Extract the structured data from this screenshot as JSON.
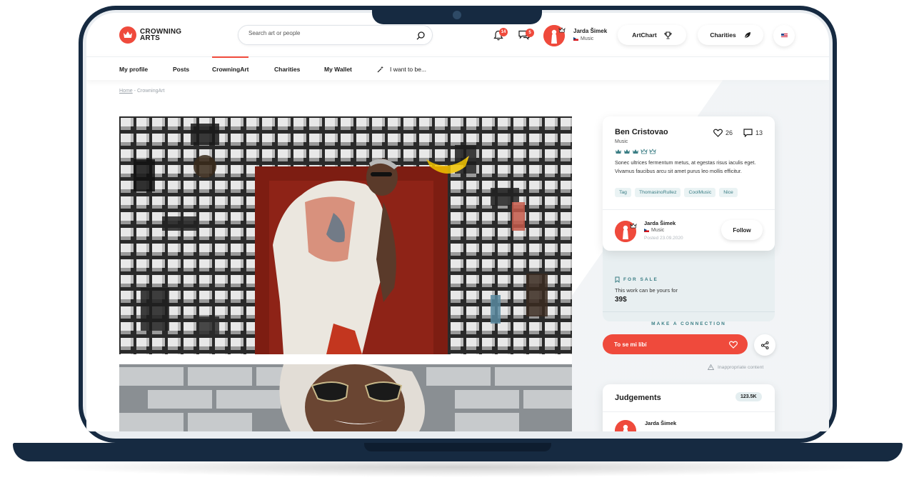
{
  "brand": {
    "line1": "CROWNING",
    "line2": "ARTS",
    "accent": "#ef4a3c",
    "navy": "#162a41"
  },
  "header": {
    "search_placeholder": "Search art or people",
    "notifications_count": "14",
    "messages_count": "5",
    "user": {
      "name": "Jarda Šimek",
      "category": "Music"
    },
    "artchart_label": "ArtChart",
    "charities_label": "Charities"
  },
  "nav": {
    "items": [
      {
        "label": "My profile"
      },
      {
        "label": "Posts"
      },
      {
        "label": "CrowningArt"
      },
      {
        "label": "Charities"
      },
      {
        "label": "My Wallet"
      }
    ],
    "want_label": "I want to be..."
  },
  "breadcrumb": {
    "home": "Home",
    "sep": "-",
    "current": "CrowningArt"
  },
  "artwork": {
    "artist": "Ben Cristovao",
    "category": "Music",
    "likes": "26",
    "comments": "13",
    "crowns_filled": 3,
    "crowns_total": 5,
    "description": "Sonec ultrices fermentum metus, at egestas risus iaculis eget. Vivamus faucibus arcu sit amet purus leo mollis efficitur.",
    "tags": [
      "Tag",
      "ThomasinoRullez",
      "CoolMusic",
      "Nice"
    ],
    "poster": {
      "name": "Jarda Šimek",
      "category": "Music",
      "posted": "Posted 23.09.2020"
    },
    "follow_label": "Follow"
  },
  "sale": {
    "label": "FOR SALE",
    "text": "This work can be yours for",
    "price": "39$",
    "connect_label": "MAKE A CONNECTION"
  },
  "actions": {
    "love_label": "To se mi líbí",
    "inappropriate_label": "Inappropriate content"
  },
  "judgements": {
    "title": "Judgements",
    "count": "123.5K",
    "first_user": "Jarda Šimek"
  }
}
